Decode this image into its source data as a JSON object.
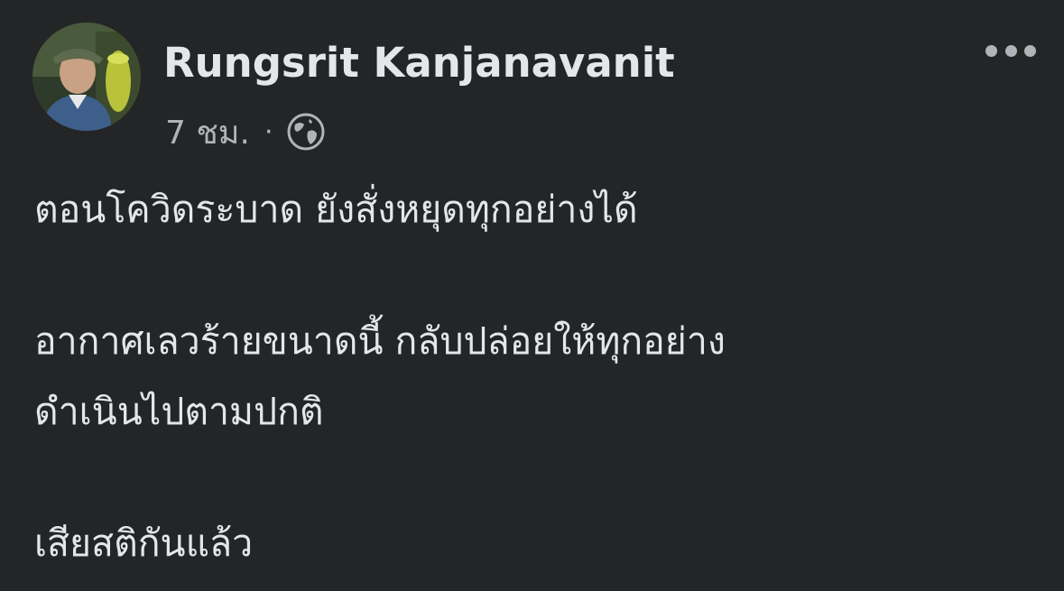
{
  "post": {
    "author": {
      "name": "Rungsrit Kanjanavanit",
      "avatar_icon": "profile-photo"
    },
    "meta": {
      "time": "7 ชม.",
      "separator": "·",
      "privacy_icon": "globe-icon"
    },
    "menu_icon": "more-options-icon",
    "text": {
      "line1": "ตอนโควิดระบาด ยังสั่งหยุดทุกอย่างได้",
      "line2": "อากาศเลวร้ายขนาดนี้ กลับปล่อยให้ทุกอย่าง",
      "line3": "ดำเนินไปตามปกติ",
      "line4": "เสียสติกันแล้ว"
    }
  },
  "colors": {
    "background": "#242526",
    "primary_text": "#e4e6eb",
    "secondary_text": "#b0b3b8"
  }
}
